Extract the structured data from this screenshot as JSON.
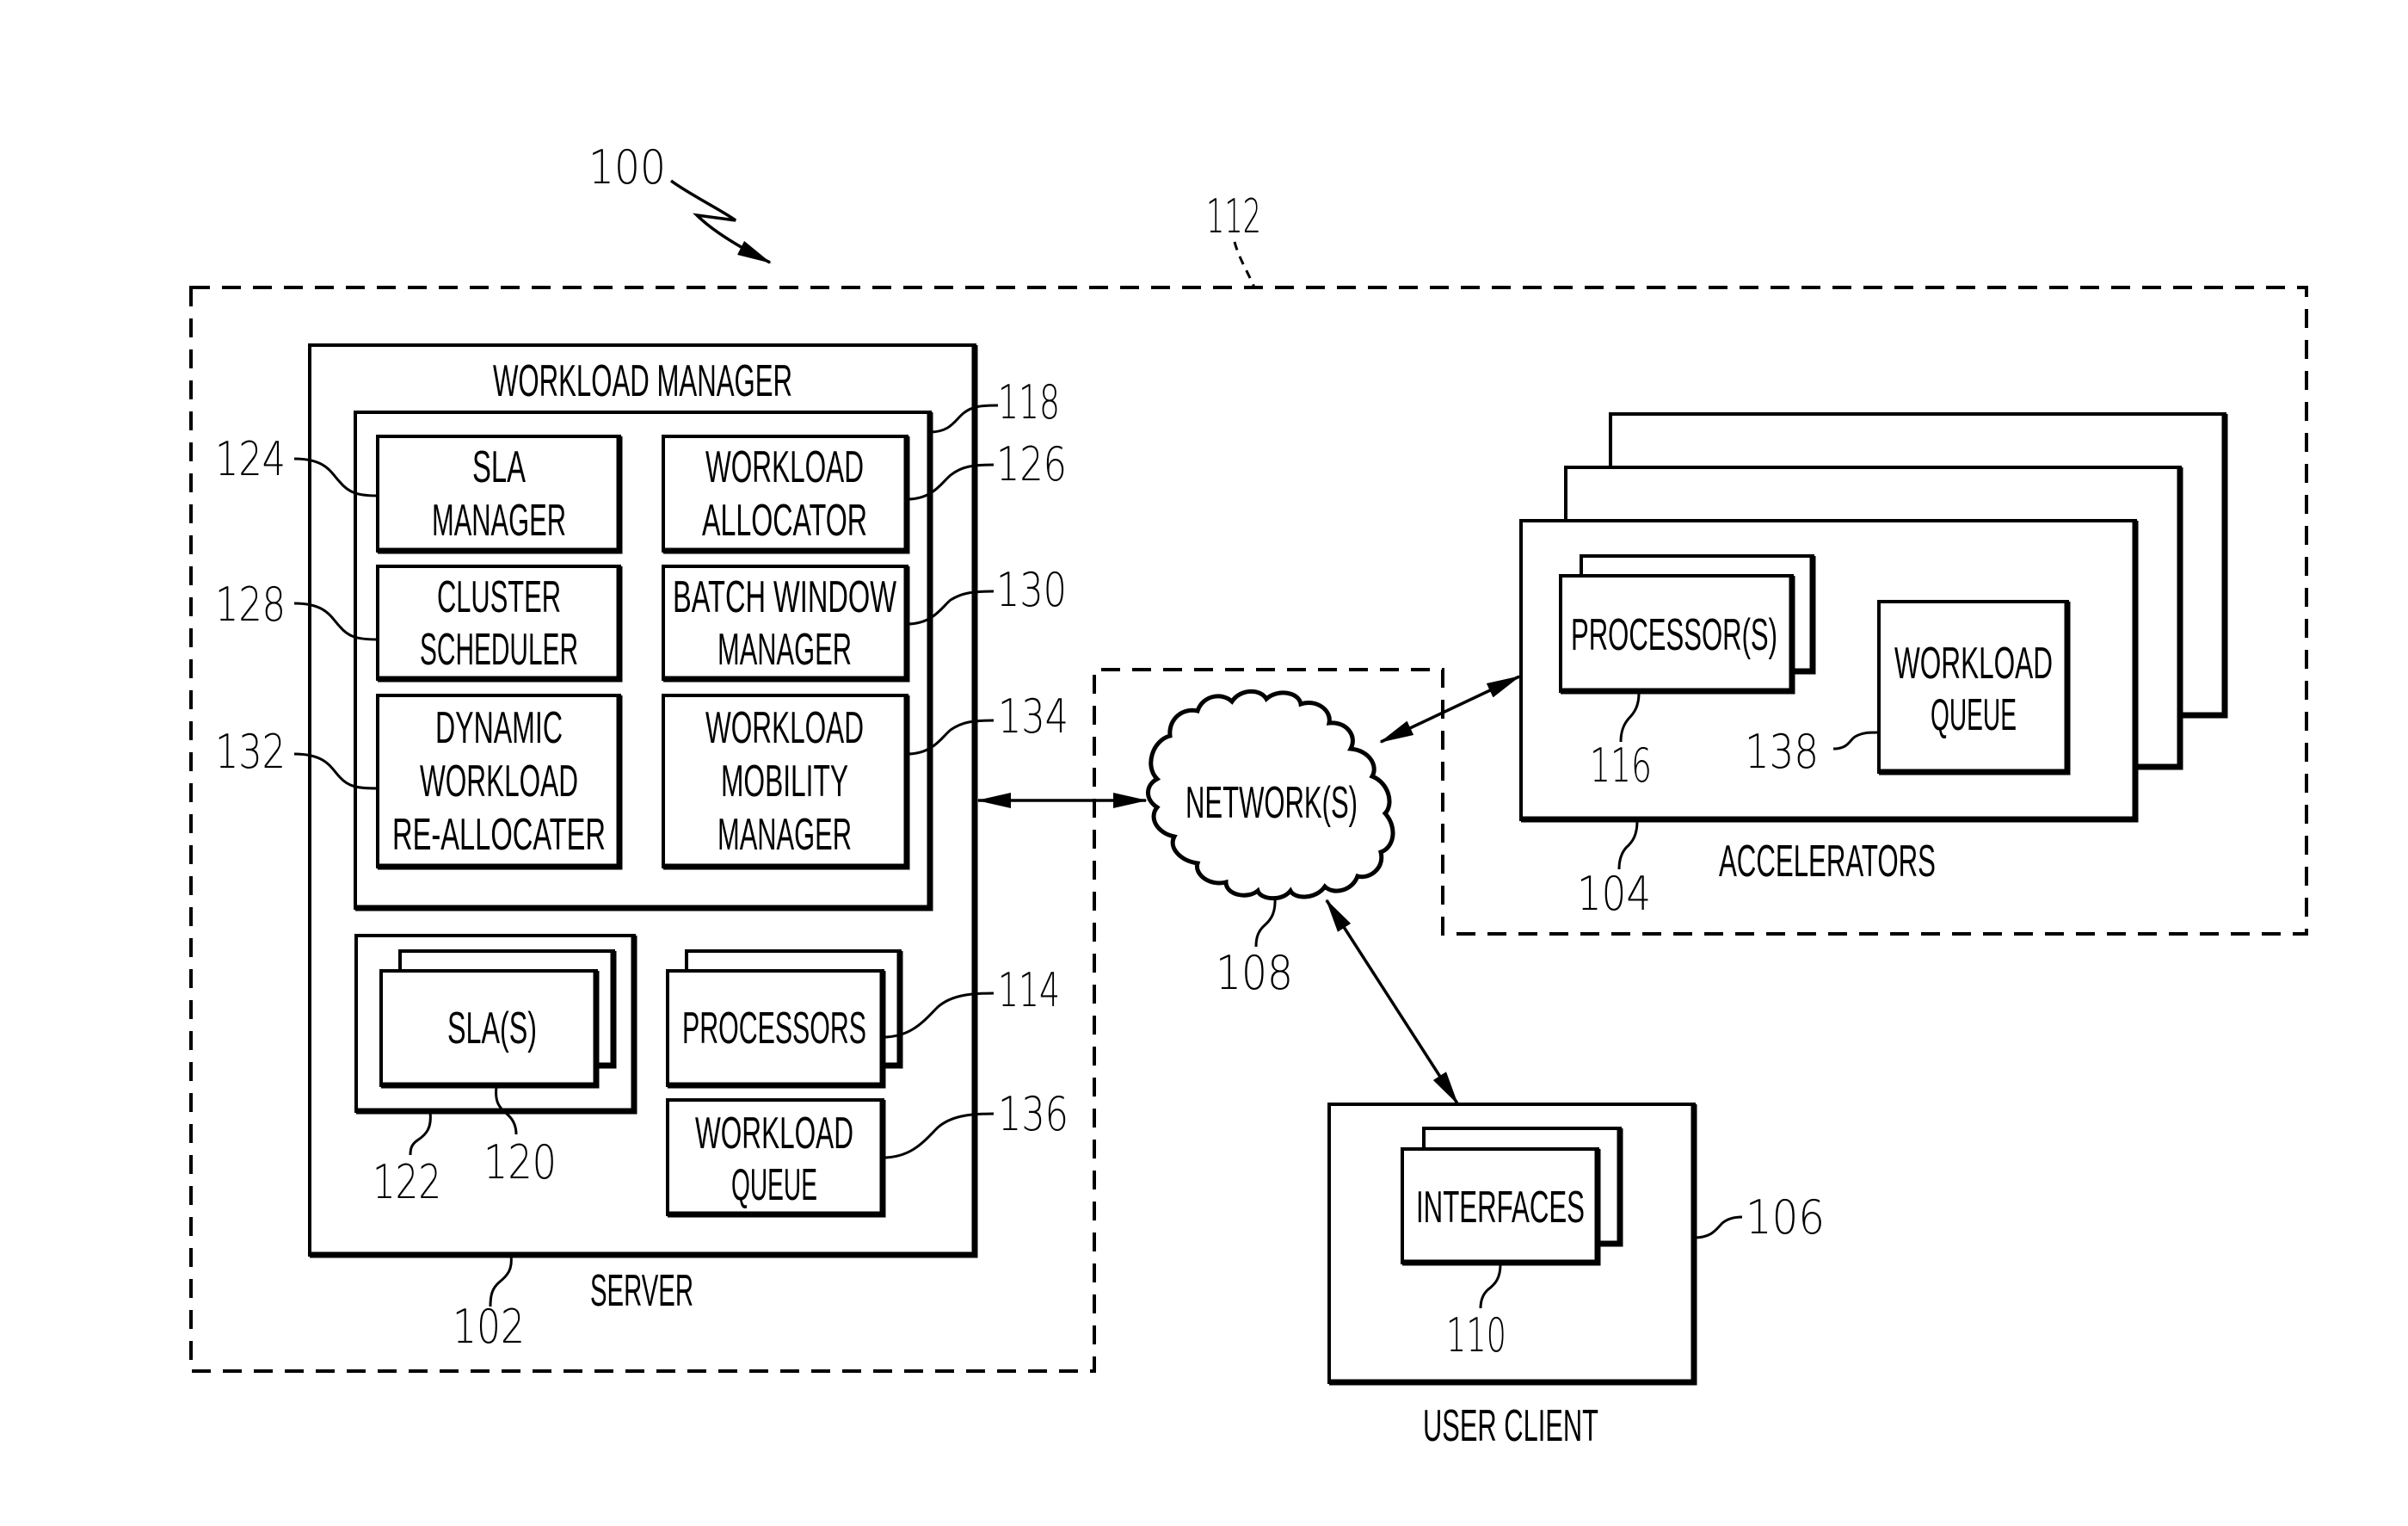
{
  "figure": {
    "system_ref": "100",
    "environment_ref": "112"
  },
  "server": {
    "label": "SERVER",
    "ref": "102",
    "workload_manager": {
      "title": "WORKLOAD MANAGER",
      "ref": "118",
      "components": [
        {
          "ref": "124",
          "lines": [
            "SLA",
            "MANAGER"
          ]
        },
        {
          "ref": "126",
          "lines": [
            "WORKLOAD",
            "ALLOCATOR"
          ]
        },
        {
          "ref": "128",
          "lines": [
            "CLUSTER",
            "SCHEDULER"
          ]
        },
        {
          "ref": "130",
          "lines": [
            "BATCH WINDOW",
            "MANAGER"
          ]
        },
        {
          "ref": "132",
          "lines": [
            "DYNAMIC",
            "WORKLOAD",
            "RE-ALLOCATER"
          ]
        },
        {
          "ref": "134",
          "lines": [
            "WORKLOAD",
            "MOBILITY",
            "MANAGER"
          ]
        }
      ]
    },
    "slas": {
      "label": "SLA(S)",
      "ref": "120",
      "container_ref": "122"
    },
    "processors": {
      "label": "PROCESSORS",
      "ref": "114"
    },
    "workload_queue": {
      "lines": [
        "WORKLOAD",
        "QUEUE"
      ],
      "ref": "136"
    }
  },
  "network": {
    "label": "NETWORK(S)",
    "ref": "108"
  },
  "accelerators": {
    "label": "ACCELERATORS",
    "ref": "104",
    "processors": {
      "label": "PROCESSOR(S)",
      "ref": "116"
    },
    "workload_queue": {
      "lines": [
        "WORKLOAD",
        "QUEUE"
      ],
      "ref": "138"
    }
  },
  "user_client": {
    "label": "USER CLIENT",
    "ref": "106",
    "interfaces": {
      "label": "INTERFACES",
      "ref": "110"
    }
  },
  "colors": {
    "ink": "#000000",
    "paper": "#ffffff"
  }
}
